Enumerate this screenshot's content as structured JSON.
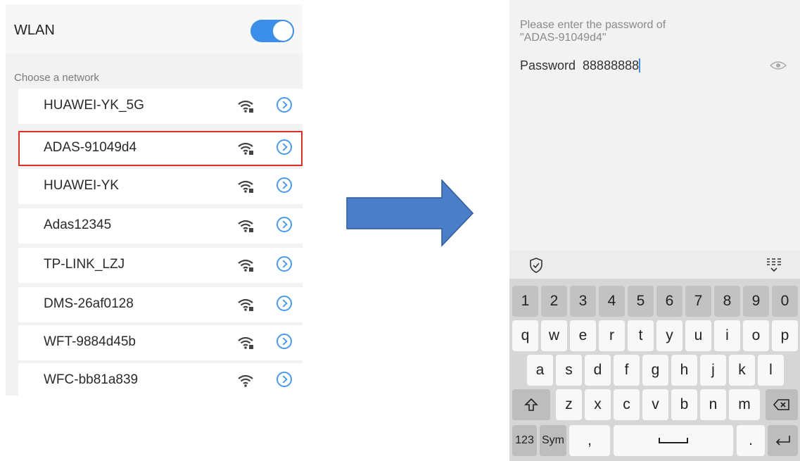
{
  "wlan": {
    "title": "WLAN",
    "toggle_on": true,
    "section_label": "Choose a network",
    "networks": [
      {
        "name": "HUAWEI-YK_5G"
      },
      {
        "name": "ADAS-91049d4"
      },
      {
        "name": "HUAWEI-YK"
      },
      {
        "name": "Adas12345"
      },
      {
        "name": "TP-LINK_LZJ"
      },
      {
        "name": "DMS-26af0128"
      },
      {
        "name": "WFT-9884d45b"
      },
      {
        "name": "WFC-bb81a839"
      }
    ],
    "highlight_color": "#d9322b",
    "accent_color": "#3b8fe8"
  },
  "password_screen": {
    "prompt_line1": "Please enter the password of",
    "prompt_line2": "\"ADAS-91049d4\"",
    "label": "Password",
    "value": "88888888"
  },
  "keyboard": {
    "numbers": [
      "1",
      "2",
      "3",
      "4",
      "5",
      "6",
      "7",
      "8",
      "9",
      "0"
    ],
    "row1": [
      "q",
      "w",
      "e",
      "r",
      "t",
      "y",
      "u",
      "i",
      "o",
      "p"
    ],
    "row2": [
      "a",
      "s",
      "d",
      "f",
      "g",
      "h",
      "j",
      "k",
      "l"
    ],
    "row3": [
      "z",
      "x",
      "c",
      "v",
      "b",
      "n",
      "m"
    ],
    "mode_123": "123",
    "mode_sym": "Sym",
    "comma": ",",
    "period": "."
  },
  "arrow_color": "#4a7ec9"
}
